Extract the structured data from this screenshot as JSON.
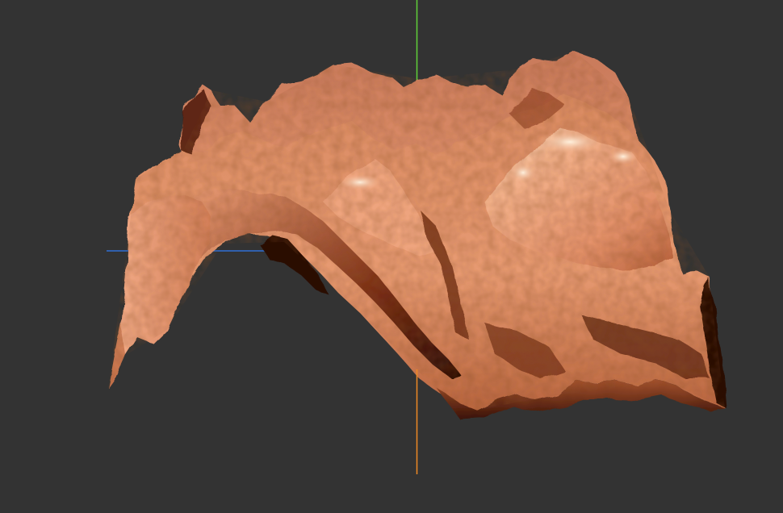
{
  "viewport": {
    "background": "#333333",
    "projection": "perspective"
  },
  "terrain": {
    "material_color": "#e0906a",
    "highlight_color": "#ffe8d0",
    "shadow_color": "#3a1206",
    "rendering": "shaded-heightmap"
  },
  "axes": {
    "x_axis_color": "#2f6fd6",
    "y_axis_color": "#5fd23a",
    "z_axis_color": "#f08a24"
  }
}
